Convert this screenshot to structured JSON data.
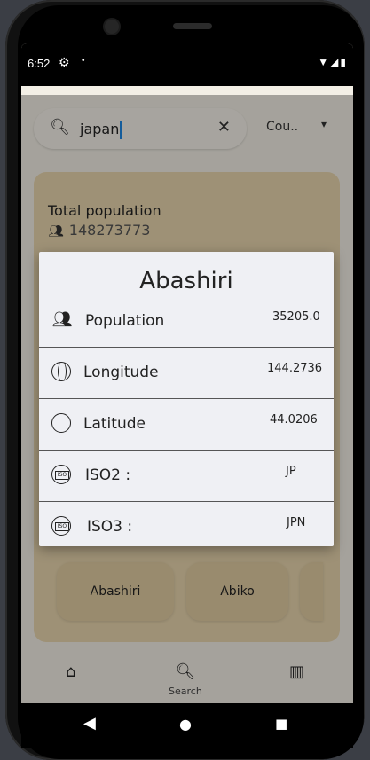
{
  "status": {
    "time": "6:52",
    "gear_icon": "gear-icon",
    "notification_dot": "•",
    "system_icons": "▼◢▮"
  },
  "search": {
    "value": "japan",
    "search_icon": "search-icon",
    "clear_icon": "close-icon"
  },
  "country_dropdown": {
    "selected": "Cou..",
    "arrow": "▾"
  },
  "summary": {
    "title": "Total population",
    "value": "148273773",
    "icon": "people-icon"
  },
  "chips": [
    "Abashiri",
    "Abiko"
  ],
  "bottom_nav": {
    "search_label": "Search"
  },
  "dialog": {
    "city": "Abashiri",
    "rows": [
      {
        "label": "Population",
        "value": "35205.0",
        "icon": "people-icon"
      },
      {
        "label": "Longitude",
        "value": "144.2736",
        "icon": "longitude-globe-icon"
      },
      {
        "label": "Latitude",
        "value": "44.0206",
        "icon": "latitude-globe-icon"
      },
      {
        "label": "ISO2 :",
        "value": "JP",
        "icon": "iso-globe-icon"
      },
      {
        "label": "ISO3 :",
        "value": "JPN",
        "icon": "iso-globe-icon"
      }
    ],
    "iso_badge": "ISO"
  },
  "system_nav": {
    "back": "◀",
    "home": "●",
    "recents": "■"
  },
  "colors": {
    "accent": "#1e88e5",
    "card": "#e9d6ae",
    "dialog": "#eff0f4"
  }
}
